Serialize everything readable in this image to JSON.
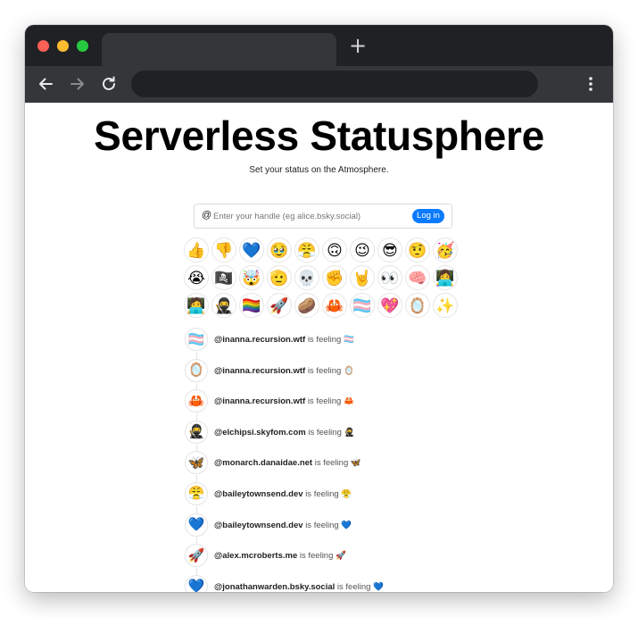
{
  "browser": {
    "new_tab_label": "+"
  },
  "page": {
    "title": "Serverless Statusphere",
    "subtitle": "Set your status on the Atmosphere."
  },
  "login": {
    "at_symbol": "@",
    "handle_placeholder": "Enter your handle (eg alice.bsky.social)",
    "handle_value": "",
    "button_label": "Log in"
  },
  "emojis": [
    "👍",
    "👎",
    "💙",
    "🥹",
    "😤",
    "🙃",
    "😉",
    "😎",
    "🤨",
    "🥳",
    "😭",
    "🏴‍☠️",
    "🤯",
    "🫡",
    "💀",
    "✊",
    "🤘",
    "👀",
    "🧠",
    "👩‍💻",
    "🧑‍💻",
    "🥷",
    "🏳️‍🌈",
    "🚀",
    "🥔",
    "🦀",
    "🏳️‍⚧️",
    "💖",
    "🪞",
    "✨"
  ],
  "feed": {
    "feeling_text": "is feeling",
    "items": [
      {
        "icon": "🏳️‍⚧️",
        "handle": "@inanna.recursion.wtf"
      },
      {
        "icon": "🪞",
        "handle": "@inanna.recursion.wtf"
      },
      {
        "icon": "🦀",
        "handle": "@inanna.recursion.wtf"
      },
      {
        "icon": "🥷",
        "handle": "@elchipsi.skyfom.com"
      },
      {
        "icon": "🦋",
        "handle": "@monarch.danaidae.net"
      },
      {
        "icon": "😤",
        "handle": "@baileytownsend.dev"
      },
      {
        "icon": "💙",
        "handle": "@baileytownsend.dev"
      },
      {
        "icon": "🚀",
        "handle": "@alex.mcroberts.me"
      },
      {
        "icon": "💙",
        "handle": "@jonathanwarden.bsky.social"
      }
    ]
  },
  "colors": {
    "titlebar": "#202124",
    "toolbar": "#35363a",
    "login_button": "#0a7aff"
  }
}
